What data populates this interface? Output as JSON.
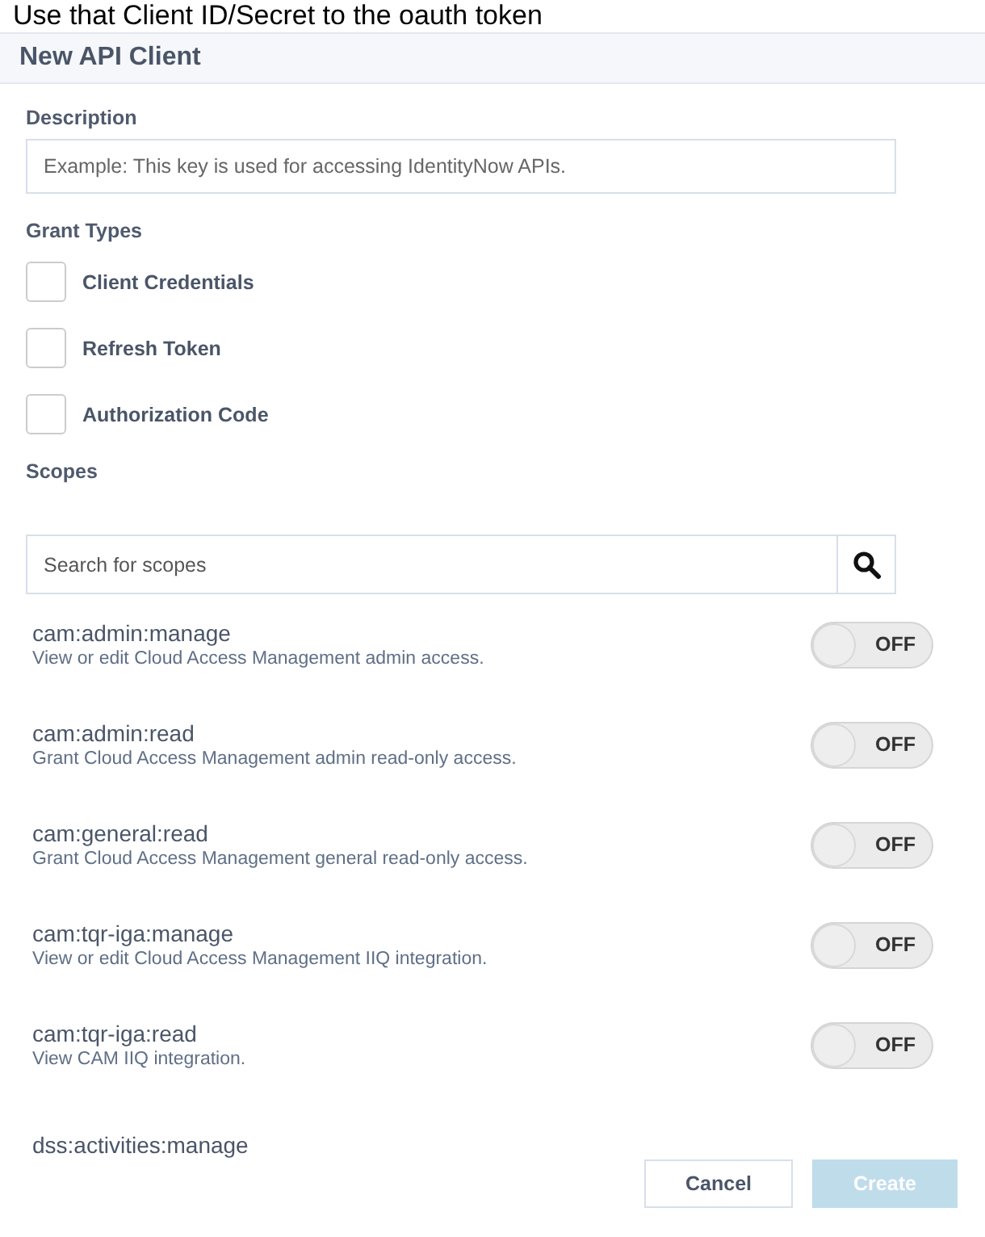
{
  "page_heading": "Use that Client ID/Secret to the oauth token",
  "dialog": {
    "title": "New API Client",
    "description": {
      "label": "Description",
      "placeholder": "Example: This key is used for accessing IdentityNow APIs."
    },
    "grant_types": {
      "label": "Grant Types",
      "items": [
        {
          "label": "Client Credentials",
          "checked": false
        },
        {
          "label": "Refresh Token",
          "checked": false
        },
        {
          "label": "Authorization Code",
          "checked": false
        }
      ]
    },
    "scopes": {
      "label": "Scopes",
      "search_placeholder": "Search for scopes",
      "items": [
        {
          "name": "cam:admin:manage",
          "description": "View or edit Cloud Access Management admin access.",
          "on": false,
          "toggle_label": "OFF"
        },
        {
          "name": "cam:admin:read",
          "description": "Grant Cloud Access Management admin read-only access.",
          "on": false,
          "toggle_label": "OFF"
        },
        {
          "name": "cam:general:read",
          "description": "Grant Cloud Access Management general read-only access.",
          "on": false,
          "toggle_label": "OFF"
        },
        {
          "name": "cam:tqr-iga:manage",
          "description": "View or edit Cloud Access Management IIQ integration.",
          "on": false,
          "toggle_label": "OFF"
        },
        {
          "name": "cam:tqr-iga:read",
          "description": "View CAM IIQ integration.",
          "on": false,
          "toggle_label": "OFF"
        },
        {
          "name": "dss:activities:manage"
        }
      ]
    },
    "buttons": [
      {
        "label": "Cancel",
        "kind": "secondary",
        "disabled": false
      },
      {
        "label": "Create",
        "kind": "primary",
        "disabled": true
      }
    ]
  }
}
